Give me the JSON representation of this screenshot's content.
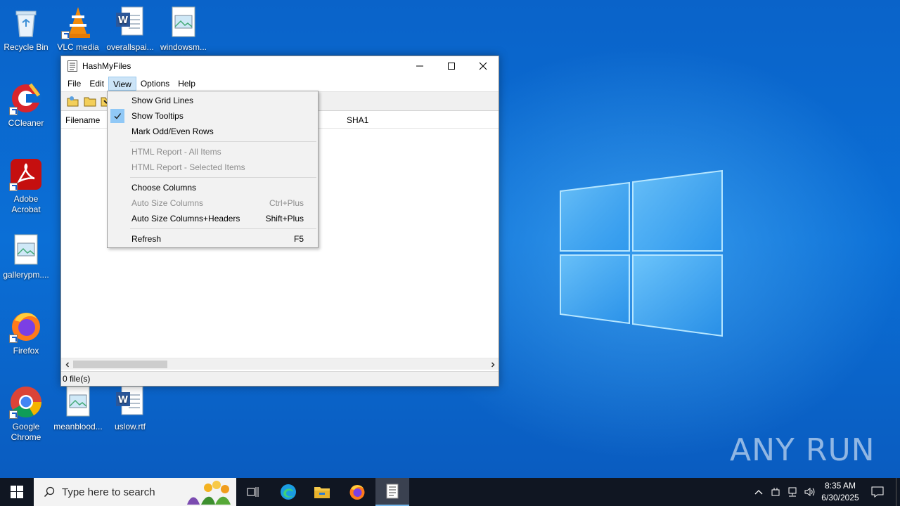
{
  "desktop": {
    "icons": [
      {
        "label": "Recycle Bin"
      },
      {
        "label": "VLC media"
      },
      {
        "label": "overallspai..."
      },
      {
        "label": "windowsm..."
      },
      {
        "label": "CCleaner"
      },
      {
        "label": "Adobe Acrobat"
      },
      {
        "label": "gallerypm...."
      },
      {
        "label": "Firefox"
      },
      {
        "label": "Google Chrome"
      },
      {
        "label": "meanblood..."
      },
      {
        "label": "uslow.rtf"
      }
    ],
    "watermark": "ANY RUN"
  },
  "window": {
    "title": "HashMyFiles",
    "menu": [
      "File",
      "Edit",
      "View",
      "Options",
      "Help"
    ],
    "active_menu": "View",
    "columns": [
      "Filename",
      "SHA1"
    ],
    "status": "0 file(s)"
  },
  "view_menu": {
    "show_grid_lines": "Show Grid Lines",
    "show_tooltips": "Show Tooltips",
    "show_tooltips_checked": true,
    "mark_odd_even": "Mark Odd/Even Rows",
    "html_all": "HTML Report - All Items",
    "html_selected": "HTML Report - Selected Items",
    "choose_columns": "Choose Columns",
    "auto_size": "Auto Size Columns",
    "auto_size_shortcut": "Ctrl+Plus",
    "auto_size_headers": "Auto Size Columns+Headers",
    "auto_size_headers_shortcut": "Shift+Plus",
    "refresh": "Refresh",
    "refresh_shortcut": "F5"
  },
  "taskbar": {
    "search_placeholder": "Type here to search",
    "time": "8:35 AM",
    "date": "6/30/2025"
  }
}
